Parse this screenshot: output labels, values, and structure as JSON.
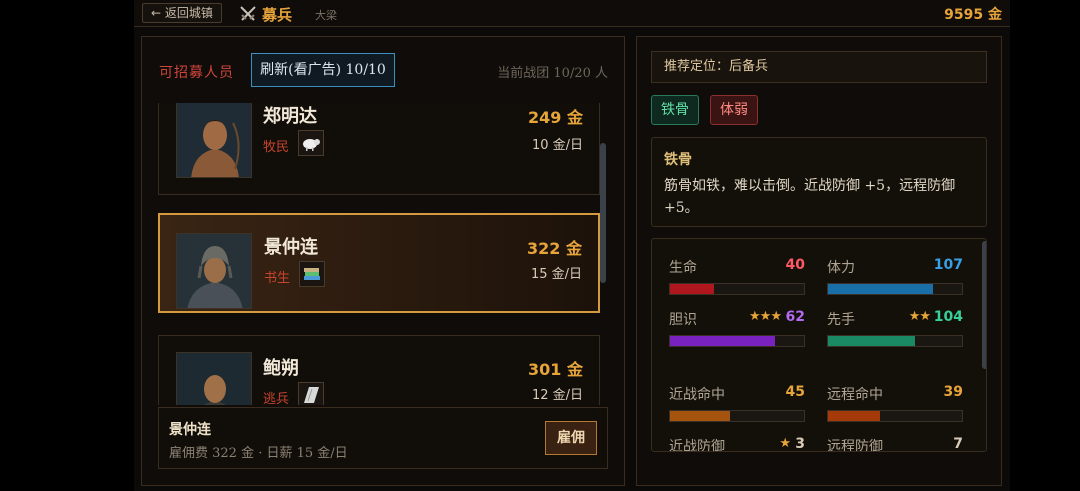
{
  "topbar": {
    "back_label": "← 返回城镇",
    "title": "募兵",
    "subtitle": "大梁",
    "gold": "9595 金"
  },
  "left": {
    "recruit_label": "可招募人员",
    "refresh_label": "刷新(看广告) 10/10",
    "band_count": "当前战团 10/20 人",
    "recruits": [
      {
        "name": "郑明达",
        "job": "牧民",
        "job_icon": "sheep-icon",
        "price": "249 金",
        "wage": "10 金/日",
        "selected": false
      },
      {
        "name": "景仲连",
        "job": "书生",
        "job_icon": "books-icon",
        "price": "322 金",
        "wage": "15 金/日",
        "selected": true
      },
      {
        "name": "鲍朔",
        "job": "逃兵",
        "job_icon": "cloth-icon",
        "price": "301 金",
        "wage": "12 金/日",
        "selected": false
      }
    ],
    "hire": {
      "name": "景仲连",
      "info": "雇佣费 322 金 · 日薪 15 金/日",
      "button": "雇佣"
    }
  },
  "right": {
    "role": "推荐定位：后备兵",
    "tags": [
      "铁骨",
      "体弱"
    ],
    "trait_title": "铁骨",
    "trait_desc": "筋骨如铁，难以击倒。近战防御 +5，远程防御 +5。",
    "stats": [
      {
        "label": "生命",
        "value": "40",
        "stars": "",
        "color": "#ff5a64",
        "bar": "#b0161e",
        "fill": 0.33
      },
      {
        "label": "体力",
        "value": "107",
        "stars": "",
        "color": "#3aa0e6",
        "bar": "#1a6fa8",
        "fill": 0.78
      },
      {
        "label": "胆识",
        "value": "62",
        "stars": "★★★",
        "color": "#b26af0",
        "bar": "#7a22c0",
        "fill": 0.78
      },
      {
        "label": "先手",
        "value": "104",
        "stars": "★★",
        "color": "#38d09a",
        "bar": "#1a8a64",
        "fill": 0.65
      },
      {
        "label": "近战命中",
        "value": "45",
        "stars": "",
        "color": "#e6a43a",
        "bar": "#a4540e",
        "fill": 0.45
      },
      {
        "label": "远程命中",
        "value": "39",
        "stars": "",
        "color": "#e6a43a",
        "bar": "#a43a0a",
        "fill": 0.39
      },
      {
        "label": "近战防御",
        "value": "3",
        "stars": "★",
        "color": "#d8cbb8",
        "bar": "#6a5a48",
        "fill": 0.05
      },
      {
        "label": "远程防御",
        "value": "7",
        "stars": "",
        "color": "#d8cbb8",
        "bar": "#6a5a48",
        "fill": 0.1
      }
    ]
  }
}
